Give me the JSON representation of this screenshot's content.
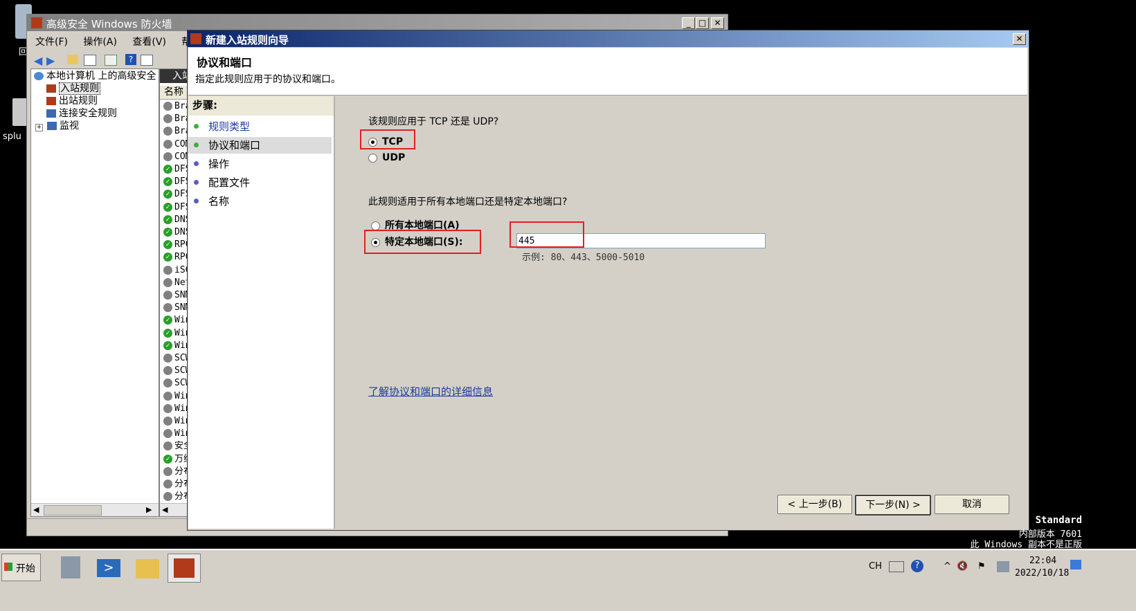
{
  "desktop": {
    "icon_labels": [
      "回",
      "splu"
    ],
    "watermark": {
      "edition": "Standard",
      "build": "内部版本 7601",
      "notice": "此 Windows 副本不是正版"
    }
  },
  "mmc": {
    "title": "高级安全 Windows 防火墙",
    "menu": [
      "文件(F)",
      "操作(A)",
      "查看(V)",
      "帮"
    ],
    "tree": [
      "本地计算机 上的高级安全",
      "入站规则",
      "出站规则",
      "连接安全规则",
      "监视"
    ],
    "list_tab": "入站",
    "list_header": "名称",
    "list_rows": [
      {
        "name": "Bra",
        "enabled": false
      },
      {
        "name": "Bra",
        "enabled": false
      },
      {
        "name": "Bra",
        "enabled": false
      },
      {
        "name": "COM",
        "enabled": false
      },
      {
        "name": "COM",
        "enabled": false
      },
      {
        "name": "DFS",
        "enabled": true
      },
      {
        "name": "DFS",
        "enabled": true
      },
      {
        "name": "DFS",
        "enabled": true
      },
      {
        "name": "DFS",
        "enabled": true
      },
      {
        "name": "DNS",
        "enabled": true
      },
      {
        "name": "DNS",
        "enabled": true
      },
      {
        "name": "RPC",
        "enabled": true
      },
      {
        "name": "RPC",
        "enabled": true
      },
      {
        "name": "iSC",
        "enabled": false
      },
      {
        "name": "Net",
        "enabled": false
      },
      {
        "name": "SNM",
        "enabled": false
      },
      {
        "name": "SNM",
        "enabled": false
      },
      {
        "name": "Win",
        "enabled": true
      },
      {
        "name": "Win",
        "enabled": true
      },
      {
        "name": "Win",
        "enabled": true
      },
      {
        "name": "SCW",
        "enabled": false
      },
      {
        "name": "SCW",
        "enabled": false
      },
      {
        "name": "SCW",
        "enabled": false
      },
      {
        "name": "Win",
        "enabled": false
      },
      {
        "name": "Win",
        "enabled": false
      },
      {
        "name": "Win",
        "enabled": false
      },
      {
        "name": "Win",
        "enabled": false
      },
      {
        "name": "安全",
        "enabled": false
      },
      {
        "name": "万维",
        "enabled": true
      },
      {
        "name": "分布",
        "enabled": false
      },
      {
        "name": "分布",
        "enabled": false
      },
      {
        "name": "分布",
        "enabled": false
      }
    ]
  },
  "wizard": {
    "title": "新建入站规则向导",
    "heading": "协议和端口",
    "subheading": "指定此规则应用于的协议和端口。",
    "steps_label": "步骤:",
    "steps": [
      {
        "label": "规则类型",
        "state": "done"
      },
      {
        "label": "协议和端口",
        "state": "current"
      },
      {
        "label": "操作",
        "state": "pending"
      },
      {
        "label": "配置文件",
        "state": "pending"
      },
      {
        "label": "名称",
        "state": "pending"
      }
    ],
    "protocol_question": "该规则应用于 TCP 还是 UDP?",
    "protocol_options": [
      {
        "label": "TCP",
        "selected": true
      },
      {
        "label": "UDP",
        "selected": false
      }
    ],
    "port_question": "此规则适用于所有本地端口还是特定本地端口?",
    "port_options": [
      {
        "label": "所有本地端口(A)",
        "selected": false
      },
      {
        "label": "特定本地端口(S):",
        "selected": true
      }
    ],
    "port_value": "445",
    "port_example": "示例: 80、443、5000-5010",
    "help_link": "了解协议和端口的详细信息",
    "buttons": {
      "back": "< 上一步(B)",
      "next": "下一步(N) >",
      "cancel": "取消"
    }
  },
  "taskbar": {
    "start_label": "开始",
    "lang": "CH",
    "time": "22:04",
    "date": "2022/10/18"
  }
}
